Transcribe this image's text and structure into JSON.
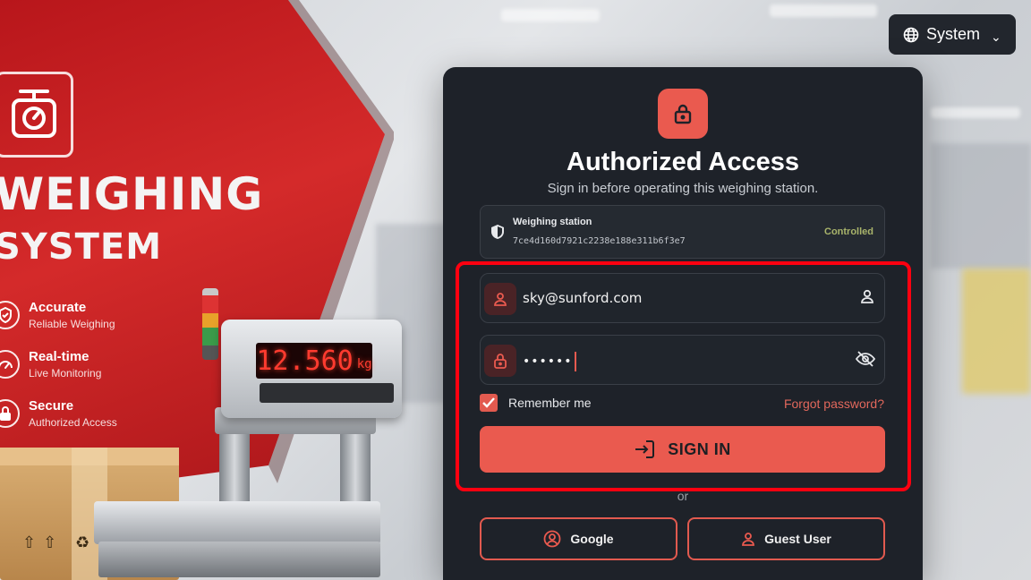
{
  "language": {
    "label": "System"
  },
  "promo": {
    "title_line1": "WEIGHING",
    "title_line2": "SYSTEM",
    "features": [
      {
        "title": "Accurate",
        "subtitle": "Reliable Weighing"
      },
      {
        "title": "Real-time",
        "subtitle": "Live Monitoring"
      },
      {
        "title": "Secure",
        "subtitle": "Authorized Access"
      }
    ],
    "display_value": "12.560",
    "display_unit": "kg"
  },
  "login": {
    "title": "Authorized Access",
    "subtitle": "Sign in before operating this weighing station.",
    "station": {
      "label": "Weighing station",
      "id": "7ce4d160d7921c2238e188e311b6f3e7",
      "status": "Controlled"
    },
    "email": {
      "value": "sky@sunford.com"
    },
    "password": {
      "masked_value": "••••••"
    },
    "remember_me": {
      "label": "Remember me",
      "checked": true
    },
    "forgot_password": "Forgot password?",
    "sign_in": "SIGN IN",
    "or": "or",
    "google": "Google",
    "guest": "Guest User"
  },
  "colors": {
    "accent": "#ea5a4f",
    "card_bg": "#1e2229",
    "promo_red": "#c41f23",
    "highlight": "#ff0010"
  }
}
